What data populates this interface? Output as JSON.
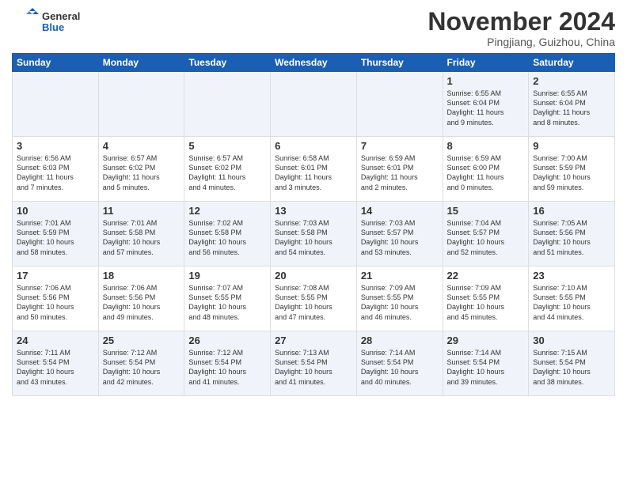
{
  "logo": {
    "text_general": "General",
    "text_blue": "Blue"
  },
  "header": {
    "month": "November 2024",
    "location": "Pingjiang, Guizhou, China"
  },
  "weekdays": [
    "Sunday",
    "Monday",
    "Tuesday",
    "Wednesday",
    "Thursday",
    "Friday",
    "Saturday"
  ],
  "weeks": [
    [
      {
        "day": "",
        "info": ""
      },
      {
        "day": "",
        "info": ""
      },
      {
        "day": "",
        "info": ""
      },
      {
        "day": "",
        "info": ""
      },
      {
        "day": "",
        "info": ""
      },
      {
        "day": "1",
        "info": "Sunrise: 6:55 AM\nSunset: 6:04 PM\nDaylight: 11 hours\nand 9 minutes."
      },
      {
        "day": "2",
        "info": "Sunrise: 6:55 AM\nSunset: 6:04 PM\nDaylight: 11 hours\nand 8 minutes."
      }
    ],
    [
      {
        "day": "3",
        "info": "Sunrise: 6:56 AM\nSunset: 6:03 PM\nDaylight: 11 hours\nand 7 minutes."
      },
      {
        "day": "4",
        "info": "Sunrise: 6:57 AM\nSunset: 6:02 PM\nDaylight: 11 hours\nand 5 minutes."
      },
      {
        "day": "5",
        "info": "Sunrise: 6:57 AM\nSunset: 6:02 PM\nDaylight: 11 hours\nand 4 minutes."
      },
      {
        "day": "6",
        "info": "Sunrise: 6:58 AM\nSunset: 6:01 PM\nDaylight: 11 hours\nand 3 minutes."
      },
      {
        "day": "7",
        "info": "Sunrise: 6:59 AM\nSunset: 6:01 PM\nDaylight: 11 hours\nand 2 minutes."
      },
      {
        "day": "8",
        "info": "Sunrise: 6:59 AM\nSunset: 6:00 PM\nDaylight: 11 hours\nand 0 minutes."
      },
      {
        "day": "9",
        "info": "Sunrise: 7:00 AM\nSunset: 5:59 PM\nDaylight: 10 hours\nand 59 minutes."
      }
    ],
    [
      {
        "day": "10",
        "info": "Sunrise: 7:01 AM\nSunset: 5:59 PM\nDaylight: 10 hours\nand 58 minutes."
      },
      {
        "day": "11",
        "info": "Sunrise: 7:01 AM\nSunset: 5:58 PM\nDaylight: 10 hours\nand 57 minutes."
      },
      {
        "day": "12",
        "info": "Sunrise: 7:02 AM\nSunset: 5:58 PM\nDaylight: 10 hours\nand 56 minutes."
      },
      {
        "day": "13",
        "info": "Sunrise: 7:03 AM\nSunset: 5:58 PM\nDaylight: 10 hours\nand 54 minutes."
      },
      {
        "day": "14",
        "info": "Sunrise: 7:03 AM\nSunset: 5:57 PM\nDaylight: 10 hours\nand 53 minutes."
      },
      {
        "day": "15",
        "info": "Sunrise: 7:04 AM\nSunset: 5:57 PM\nDaylight: 10 hours\nand 52 minutes."
      },
      {
        "day": "16",
        "info": "Sunrise: 7:05 AM\nSunset: 5:56 PM\nDaylight: 10 hours\nand 51 minutes."
      }
    ],
    [
      {
        "day": "17",
        "info": "Sunrise: 7:06 AM\nSunset: 5:56 PM\nDaylight: 10 hours\nand 50 minutes."
      },
      {
        "day": "18",
        "info": "Sunrise: 7:06 AM\nSunset: 5:56 PM\nDaylight: 10 hours\nand 49 minutes."
      },
      {
        "day": "19",
        "info": "Sunrise: 7:07 AM\nSunset: 5:55 PM\nDaylight: 10 hours\nand 48 minutes."
      },
      {
        "day": "20",
        "info": "Sunrise: 7:08 AM\nSunset: 5:55 PM\nDaylight: 10 hours\nand 47 minutes."
      },
      {
        "day": "21",
        "info": "Sunrise: 7:09 AM\nSunset: 5:55 PM\nDaylight: 10 hours\nand 46 minutes."
      },
      {
        "day": "22",
        "info": "Sunrise: 7:09 AM\nSunset: 5:55 PM\nDaylight: 10 hours\nand 45 minutes."
      },
      {
        "day": "23",
        "info": "Sunrise: 7:10 AM\nSunset: 5:55 PM\nDaylight: 10 hours\nand 44 minutes."
      }
    ],
    [
      {
        "day": "24",
        "info": "Sunrise: 7:11 AM\nSunset: 5:54 PM\nDaylight: 10 hours\nand 43 minutes."
      },
      {
        "day": "25",
        "info": "Sunrise: 7:12 AM\nSunset: 5:54 PM\nDaylight: 10 hours\nand 42 minutes."
      },
      {
        "day": "26",
        "info": "Sunrise: 7:12 AM\nSunset: 5:54 PM\nDaylight: 10 hours\nand 41 minutes."
      },
      {
        "day": "27",
        "info": "Sunrise: 7:13 AM\nSunset: 5:54 PM\nDaylight: 10 hours\nand 41 minutes."
      },
      {
        "day": "28",
        "info": "Sunrise: 7:14 AM\nSunset: 5:54 PM\nDaylight: 10 hours\nand 40 minutes."
      },
      {
        "day": "29",
        "info": "Sunrise: 7:14 AM\nSunset: 5:54 PM\nDaylight: 10 hours\nand 39 minutes."
      },
      {
        "day": "30",
        "info": "Sunrise: 7:15 AM\nSunset: 5:54 PM\nDaylight: 10 hours\nand 38 minutes."
      }
    ]
  ]
}
